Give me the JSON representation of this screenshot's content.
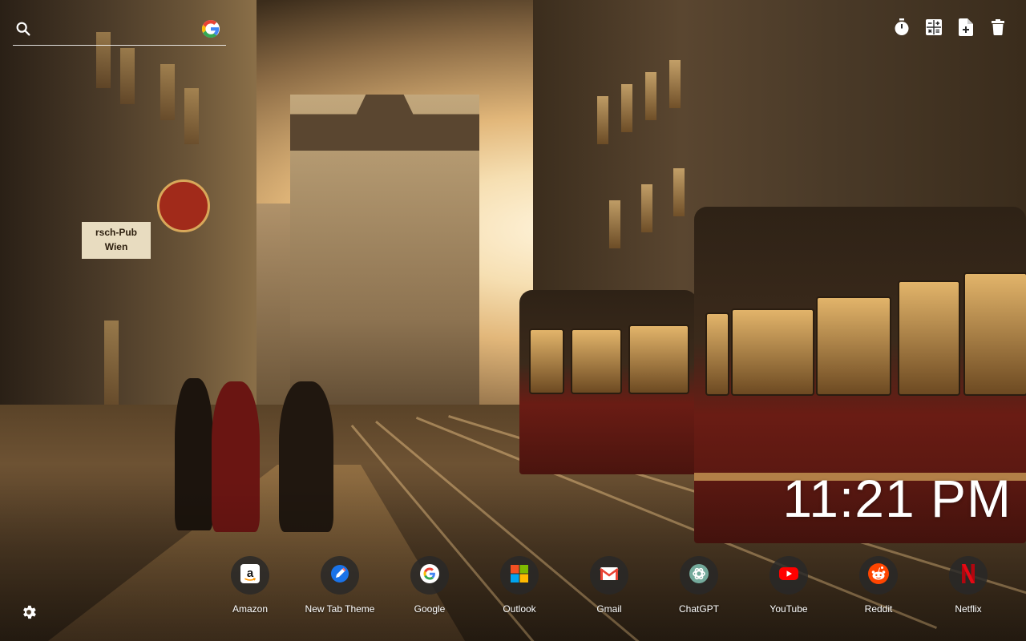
{
  "search": {
    "placeholder": "",
    "icon": "search-icon",
    "engine_icon": "google-icon"
  },
  "toolbar": [
    {
      "icon": "timer-icon"
    },
    {
      "icon": "calculator-icon"
    },
    {
      "icon": "add-note-icon"
    },
    {
      "icon": "trash-icon"
    }
  ],
  "clock": {
    "time": "11:21 PM"
  },
  "wallpaper": {
    "pub_sign_line1": "rsch-Pub",
    "pub_sign_line2": "Wien"
  },
  "shortcuts": [
    {
      "label": "Amazon",
      "icon": "amazon-icon"
    },
    {
      "label": "New Tab Theme",
      "icon": "new-tab-theme-icon"
    },
    {
      "label": "Google",
      "icon": "google-icon"
    },
    {
      "label": "Outlook",
      "icon": "outlook-icon"
    },
    {
      "label": "Gmail",
      "icon": "gmail-icon"
    },
    {
      "label": "ChatGPT",
      "icon": "chatgpt-icon"
    },
    {
      "label": "YouTube",
      "icon": "youtube-icon"
    },
    {
      "label": "Reddit",
      "icon": "reddit-icon"
    },
    {
      "label": "Netflix",
      "icon": "netflix-icon"
    }
  ],
  "settings": {
    "icon": "gear-icon"
  },
  "colors": {
    "google_blue": "#4285F4",
    "google_red": "#EA4335",
    "google_yellow": "#FBBC05",
    "google_green": "#34A853",
    "youtube_red": "#FF0000",
    "reddit_orange": "#FF4500",
    "netflix_red": "#E50914",
    "chatgpt_teal": "#74AA9C"
  }
}
